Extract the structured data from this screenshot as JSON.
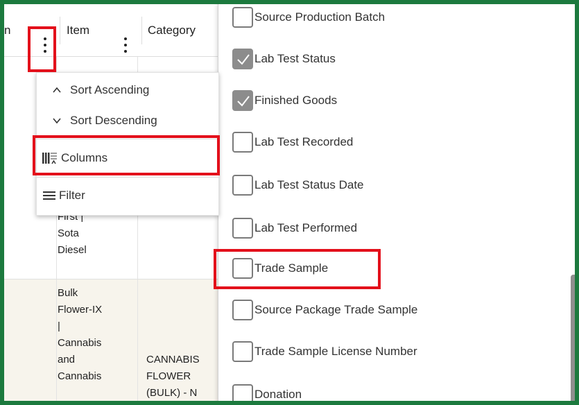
{
  "table": {
    "header": {
      "partial_label": "n",
      "item_label": "Item",
      "category_label": "Category"
    },
    "rows": [
      {
        "item_lines": "First |\nSota\nDiesel",
        "category_lines": ""
      },
      {
        "item_lines": "Bulk\nFlower-IX\n|\nCannabis\nand\nCannabis",
        "category_lines": "CANNABIS\nFLOWER\n(BULK) - N"
      }
    ]
  },
  "column_menu": {
    "sort_ascending": "Sort Ascending",
    "sort_descending": "Sort Descending",
    "columns": "Columns",
    "filter": "Filter"
  },
  "columns_panel": {
    "options": [
      {
        "label": "Source Production Batch",
        "checked": false
      },
      {
        "label": "Lab Test Status",
        "checked": true
      },
      {
        "label": "Finished Goods",
        "checked": true
      },
      {
        "label": "Lab Test Recorded",
        "checked": false
      },
      {
        "label": "Lab Test Status Date",
        "checked": false
      },
      {
        "label": "Lab Test Performed",
        "checked": false
      },
      {
        "label": "Trade Sample",
        "checked": false
      },
      {
        "label": "Source Package Trade Sample",
        "checked": false
      },
      {
        "label": "Trade Sample License Number",
        "checked": false
      },
      {
        "label": "Donation",
        "checked": false
      }
    ]
  },
  "colors": {
    "frame": "#1c7a3e",
    "highlight": "#e3101b",
    "checked": "#8c8c8c"
  }
}
